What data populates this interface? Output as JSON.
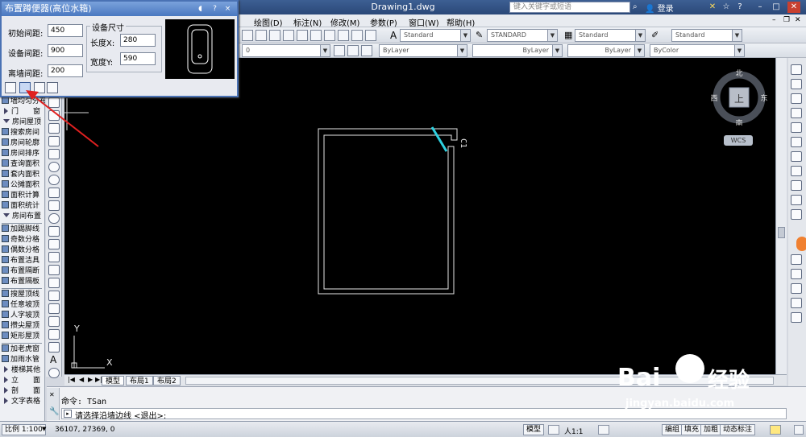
{
  "app": {
    "doc_title": "Drawing1.dwg",
    "search_placeholder": "键入关键字或短语",
    "login": "登录"
  },
  "menu": [
    "绘图(D)",
    "标注(N)",
    "修改(M)",
    "参数(P)",
    "窗口(W)",
    "帮助(H)"
  ],
  "toolbar": {
    "style_combos": [
      "Standard",
      "STANDARD",
      "Standard",
      "Standard"
    ],
    "layer_combo": "0",
    "prop_combos": [
      "ByLayer",
      "ByLayer",
      "ByLayer",
      "ByColor"
    ]
  },
  "dialog": {
    "title": "布置蹲便器(高位水箱)",
    "help_btn": "?",
    "close_btn": "×",
    "fields": [
      {
        "label": "初始间距:",
        "value": "450"
      },
      {
        "label": "设备间距:",
        "value": "900"
      },
      {
        "label": "离墙间距:",
        "value": "200"
      }
    ],
    "size_group": "设备尺寸",
    "size_fields": [
      {
        "label": "长度X:",
        "value": "280"
      },
      {
        "label": "宽度Y:",
        "value": "590"
      }
    ]
  },
  "left_panel": {
    "items": [
      {
        "label": "墙均匀分布",
        "type": "icon"
      },
      {
        "label": "门　　窗",
        "type": "arrowed"
      },
      {
        "label": "房间屋顶",
        "type": "down"
      },
      {
        "label": "搜索房间",
        "type": "icon"
      },
      {
        "label": "房间轮廓",
        "type": "icon"
      },
      {
        "label": "房间排序",
        "type": "icon"
      },
      {
        "label": "查询面积",
        "type": "icon"
      },
      {
        "label": "套内面积",
        "type": "icon"
      },
      {
        "label": "公摊面积",
        "type": "icon"
      },
      {
        "label": "面积计算",
        "type": "icon"
      },
      {
        "label": "面积统计",
        "type": "icon"
      },
      {
        "label": "房间布置",
        "type": "down"
      },
      {
        "label": "加踢脚线",
        "type": "icon"
      },
      {
        "label": "奇数分格",
        "type": "icon"
      },
      {
        "label": "偶数分格",
        "type": "icon"
      },
      {
        "label": "布置洁具",
        "type": "icon"
      },
      {
        "label": "布置隔断",
        "type": "icon"
      },
      {
        "label": "布置隔板",
        "type": "icon"
      },
      {
        "label": "搜屋顶线",
        "type": "icon"
      },
      {
        "label": "任意坡顶",
        "type": "icon"
      },
      {
        "label": "人字坡顶",
        "type": "icon"
      },
      {
        "label": "攒尖屋顶",
        "type": "icon"
      },
      {
        "label": "矩形屋顶",
        "type": "icon"
      },
      {
        "label": "加老虎窗",
        "type": "icon"
      },
      {
        "label": "加雨水管",
        "type": "icon"
      },
      {
        "label": "楼梯其他",
        "type": "arrowed"
      },
      {
        "label": "立　　面",
        "type": "arrowed"
      },
      {
        "label": "剖　　面",
        "type": "arrowed"
      },
      {
        "label": "文字表格",
        "type": "arrowed"
      }
    ]
  },
  "canvas": {
    "label_c1": "C1",
    "axis_y": "Y",
    "axis_x": "X"
  },
  "compass": {
    "north": "北",
    "south": "南",
    "east": "东",
    "west": "西",
    "center": "上",
    "wcs": "WCS"
  },
  "tabs": [
    "模型",
    "布局1",
    "布局2"
  ],
  "command": {
    "line1": "命令: TSan",
    "prompt": "请选择沿墙边线 <退出>:"
  },
  "status": {
    "scale": "比例 1:100",
    "coords": "36107, 27369, 0",
    "model": "模型",
    "anno_scale": "人1:1",
    "buttons": [
      "编组",
      "填充",
      "加粗",
      "动态标注"
    ]
  },
  "watermark": {
    "brand": "Bai",
    "brand2": "经验",
    "url": "jingyan.baidu.com"
  },
  "colors": {
    "accent": "#4a78c0",
    "window_cyan": "#2ed1e0",
    "annotation_red": "#e02020"
  }
}
